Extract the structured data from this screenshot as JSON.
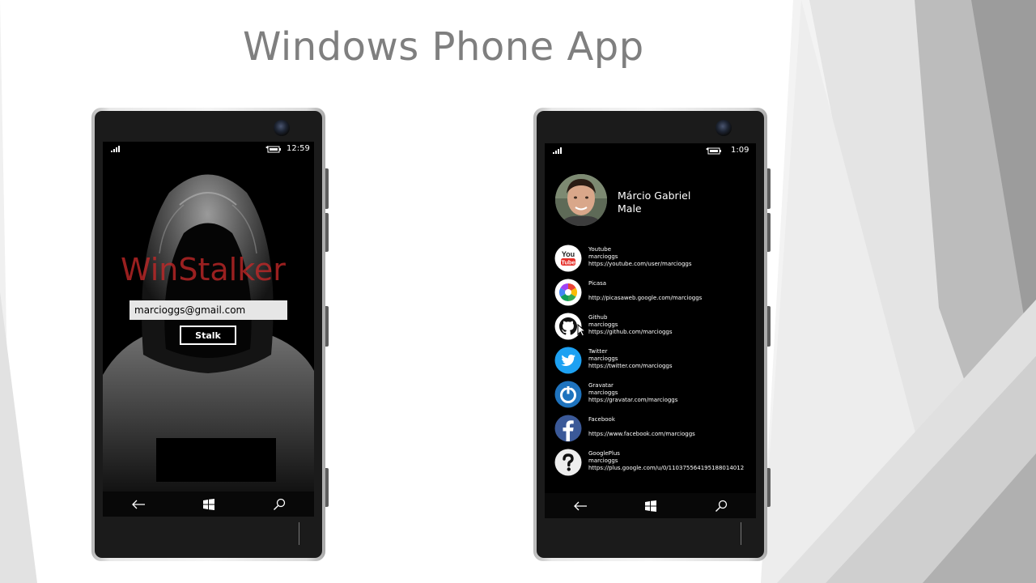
{
  "slide": {
    "title": "Windows Phone App"
  },
  "colors": {
    "brand_red": "#c42828",
    "youtube_red": "#e52d27",
    "twitter_blue": "#1da1f2",
    "gravatar_blue": "#1e73be",
    "facebook_blue": "#3b5998"
  },
  "left_phone": {
    "status": {
      "time": "12:59"
    },
    "app_title": "WinStalker",
    "email_input": {
      "value": "marcioggs@gmail.com"
    },
    "stalk_button": "Stalk",
    "nav": [
      "back-icon",
      "windows-icon",
      "search-icon"
    ]
  },
  "right_phone": {
    "status": {
      "time": "1:09"
    },
    "profile": {
      "name": "Márcio Gabriel",
      "gender": "Male"
    },
    "accounts": [
      {
        "service": "Youtube",
        "username": "marcioggs",
        "url": "https://youtube.com/user/marcioggs",
        "icon": "youtube-icon"
      },
      {
        "service": "Picasa",
        "username": "",
        "url": "http://picasaweb.google.com/marcioggs",
        "icon": "picasa-icon"
      },
      {
        "service": "Github",
        "username": "marcioggs",
        "url": "https://github.com/marcioggs",
        "icon": "github-icon"
      },
      {
        "service": "Twitter",
        "username": "marcioggs",
        "url": "https://twitter.com/marcioggs",
        "icon": "twitter-icon"
      },
      {
        "service": "Gravatar",
        "username": "marcioggs",
        "url": "https://gravatar.com/marcioggs",
        "icon": "gravatar-icon"
      },
      {
        "service": "Facebook",
        "username": "",
        "url": "https://www.facebook.com/marcioggs",
        "icon": "facebook-icon"
      },
      {
        "service": "GooglePlus",
        "username": "marcioggs",
        "url": "https://plus.google.com/u/0/110375564195188014012",
        "icon": "unknown-service-icon"
      }
    ],
    "nav": [
      "back-icon",
      "windows-icon",
      "search-icon"
    ]
  }
}
